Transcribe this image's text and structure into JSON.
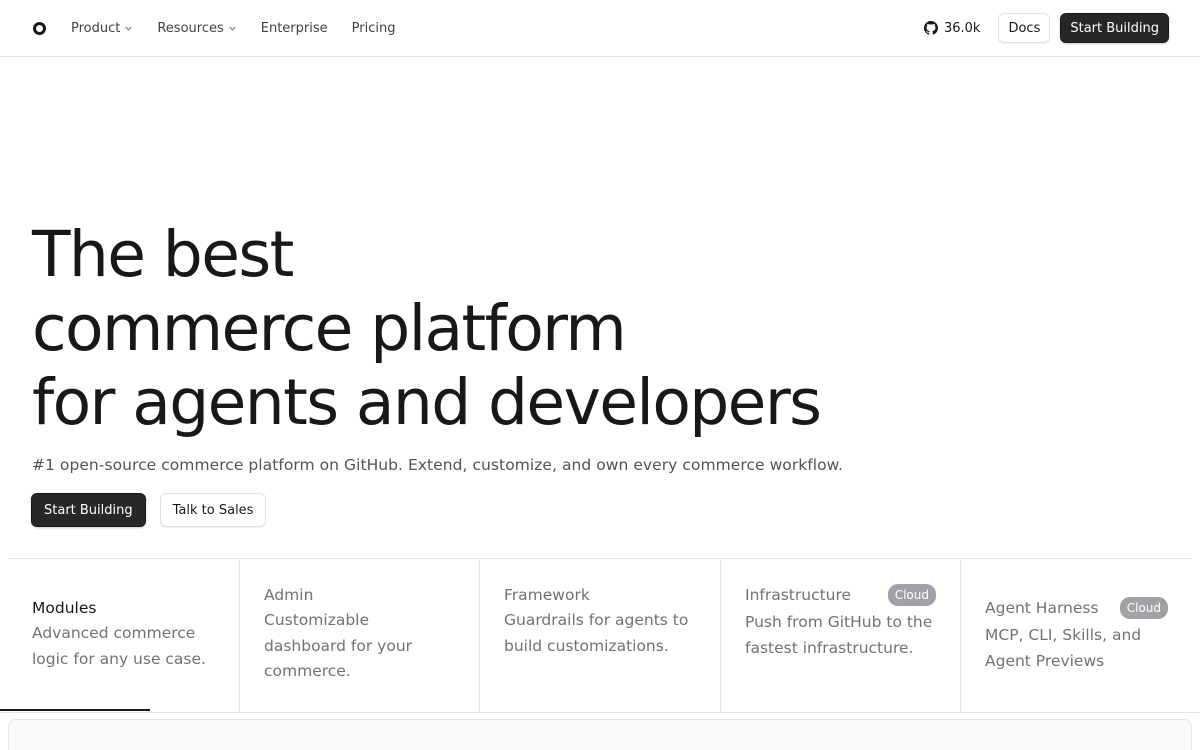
{
  "nav": {
    "links": [
      {
        "label": "Product",
        "has_dropdown": true
      },
      {
        "label": "Resources",
        "has_dropdown": true
      },
      {
        "label": "Enterprise",
        "has_dropdown": false
      },
      {
        "label": "Pricing",
        "has_dropdown": false
      }
    ],
    "github_stars": "36.0k",
    "docs_label": "Docs",
    "cta_label": "Start Building"
  },
  "hero": {
    "title_lines": [
      "The best",
      "commerce platform",
      "for agents and developers"
    ],
    "subtitle": "#1 open-source commerce platform on GitHub. Extend, customize, and own every commerce workflow.",
    "primary_cta": "Start Building",
    "secondary_cta": "Talk to Sales"
  },
  "features": [
    {
      "title": "Modules",
      "desc": "Advanced commerce logic for any use case.",
      "badge": "",
      "active": true
    },
    {
      "title": "Admin",
      "desc": "Customizable dashboard for your commerce.",
      "badge": "",
      "active": false
    },
    {
      "title": "Framework",
      "desc": "Guardrails for agents to build customizations.",
      "badge": "",
      "active": false
    },
    {
      "title": "Infrastructure",
      "desc": "Push from GitHub to the fastest infrastructure.",
      "badge": "Cloud",
      "active": false
    },
    {
      "title": "Agent Harness",
      "desc": "MCP, CLI, Skills, and Agent Previews",
      "badge": "Cloud",
      "active": false
    }
  ],
  "colors": {
    "text": "#18181b",
    "muted": "#71717a",
    "dark_button": "#27272a",
    "badge": "#a1a1aa"
  }
}
